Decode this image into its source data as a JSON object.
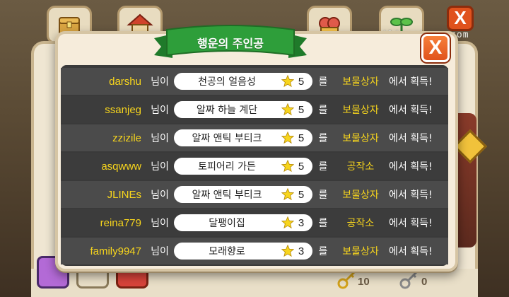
{
  "background": {
    "watermark": "jlinestory.com",
    "close_label": "X",
    "counters": [
      "10",
      "0"
    ]
  },
  "modal": {
    "title": "행운의 주인공",
    "close_label": "X",
    "nim_label": "님이",
    "reul_label": "를",
    "acquire_label": "에서 획득!",
    "rows": [
      {
        "user": "darshu",
        "item": "천공의 얼음성",
        "level": "5",
        "source": "보물상자"
      },
      {
        "user": "ssanjeg",
        "item": "알짜 하늘 계단",
        "level": "5",
        "source": "보물상자"
      },
      {
        "user": "zzizile",
        "item": "알짜 앤틱 부티크",
        "level": "5",
        "source": "보물상자"
      },
      {
        "user": "asqwww",
        "item": "토피어리 가든",
        "level": "5",
        "source": "공작소"
      },
      {
        "user": "JLINEs",
        "item": "알짜 앤틱 부티크",
        "level": "5",
        "source": "보물상자"
      },
      {
        "user": "reina779",
        "item": "달팽이집",
        "level": "3",
        "source": "공작소"
      },
      {
        "user": "family9947",
        "item": "모래향로",
        "level": "3",
        "source": "보물상자"
      }
    ]
  },
  "colors": {
    "username": "#f7d51d",
    "source": "#f7d51d",
    "ribbon": "#2e9e3a",
    "close": "#e0521d"
  }
}
